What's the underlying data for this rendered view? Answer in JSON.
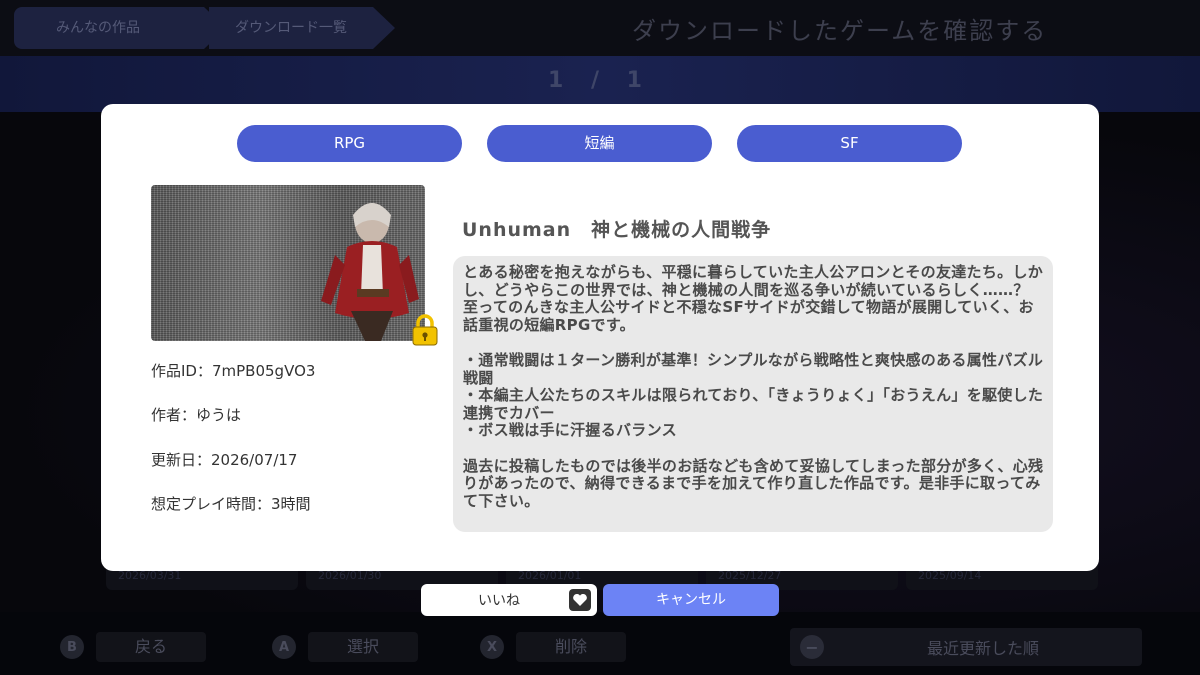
{
  "header": {
    "breadcrumbs": [
      "みんなの作品",
      "ダウンロード一覧"
    ],
    "title": "ダウンロードしたゲームを確認する"
  },
  "pager": {
    "text": "1 / 1"
  },
  "background_cards": {
    "dates": [
      "2026/03/31",
      "2026/01/30",
      "2026/01/01",
      "2025/12/27",
      "2025/09/14"
    ]
  },
  "controls": {
    "back": {
      "glyph": "B",
      "label": "戻る"
    },
    "select": {
      "glyph": "A",
      "label": "選択"
    },
    "delete": {
      "glyph": "X",
      "label": "削除"
    },
    "sort": {
      "glyph": "−",
      "label": "最近更新した順"
    }
  },
  "modal": {
    "tags": [
      "RPG",
      "短編",
      "SF"
    ],
    "thumbnail": {
      "icon": "character-thumbnail",
      "lock_icon": "lock-icon",
      "lock_color": "#f2c200"
    },
    "info": {
      "id": "作品ID：7mPB05gVO3",
      "author": "作者：ゆうは",
      "updated": "更新日：2026/07/17",
      "playtime": "想定プレイ時間：3時間"
    },
    "title": "Unhuman　神と機械の人間戦争",
    "description": "とある秘密を抱えながらも、平穏に暮らしていた主人公アロンとその友達たち。しかし、どうやらこの世界では、神と機械の人間を巡る争いが続いているらしく……？\n至ってのんきな主人公サイドと不穏なSFサイドが交錯して物語が展開していく、お話重視の短編RPGです。\n\n・通常戦闘は１ターン勝利が基準！シンプルながら戦略性と爽快感のある属性パズル戦闘\n・本編主人公たちのスキルは限られており、「きょうりょく」「おうえん」を駆使した連携でカバー\n・ボス戦は手に汗握るバランス\n\n過去に投稿したものでは後半のお話なども含めて妥協してしまった部分が多く、心残りがあったので、納得できるまで手を加えて作り直した作品です。是非手に取ってみて下さい。"
  },
  "actions": {
    "like_label": "いいね",
    "like_icon": "heart-icon",
    "cancel_label": "キャンセル"
  },
  "colors": {
    "tag": "#4a5dd0",
    "cancel": "#6c83f5",
    "modal_bg": "#ffffff"
  }
}
